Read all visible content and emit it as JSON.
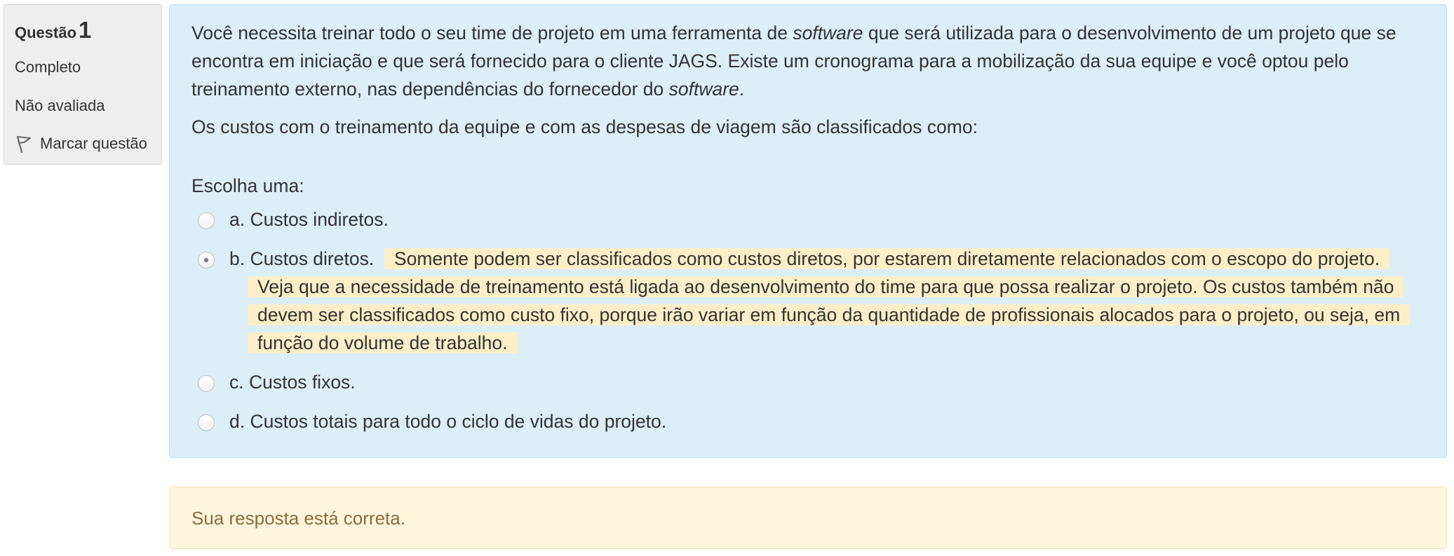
{
  "info": {
    "question_label": "Questão",
    "question_number": "1",
    "state": "Completo",
    "grade": "Não avaliada",
    "flag_label": "Marcar questão",
    "flag_icon": "flag-icon"
  },
  "question": {
    "paragraph1": {
      "t1": "Você necessita treinar todo o seu time de projeto em uma ferramenta de ",
      "em1": "software",
      "t2": " que será utilizada para o desenvolvimento de um projeto que se encontra em iniciação e que será fornecido para o cliente JAGS. Existe um cronograma para a mobilização da sua equipe e você optou pelo treinamento externo, nas dependências do fornecedor do ",
      "em2": "software",
      "t3": "."
    },
    "paragraph2": "Os custos com o treinamento da equipe e com as despesas de viagem são classificados como:",
    "prompt": "Escolha uma:",
    "options": [
      {
        "label": "a. Custos indiretos.",
        "selected": false
      },
      {
        "label": "b. Custos diretos.",
        "selected": true,
        "feedback": "Somente podem ser classificados como custos diretos, por estarem diretamente relacionados com o escopo do projeto. Veja que a necessidade de treinamento está ligada ao desenvolvimento do time para que possa realizar o projeto. Os custos também não devem ser classificados como custo fixo, porque irão variar em função da quantidade de profissionais alocados para o projeto, ou seja, em função do volume de trabalho."
      },
      {
        "label": "c. Custos fixos.",
        "selected": false
      },
      {
        "label": "d. Custos totais para todo o ciclo de vidas do projeto.",
        "selected": false
      }
    ]
  },
  "outcome": {
    "text": "Sua resposta está correta."
  },
  "colors": {
    "card_background": "#dceef7",
    "feedback_highlight": "#fcefc8",
    "outcome_background": "#fdf5dc",
    "outcome_text": "#8a6d3b"
  }
}
